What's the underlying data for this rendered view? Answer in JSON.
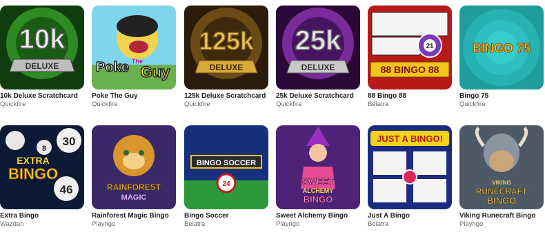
{
  "games": [
    {
      "name": "10k Deluxe Scratchcard",
      "provider": "Quickfire",
      "art": {
        "big": "10k",
        "badge": "DELUXE"
      },
      "bg": "#1d6b1a"
    },
    {
      "name": "Poke The Guy",
      "provider": "Quickfire",
      "art": {
        "big": "Poke",
        "small": "The",
        "big2": "Guy"
      },
      "bg": "#6fd0e6"
    },
    {
      "name": "125k Deluxe Scratchcard",
      "provider": "Quickfire",
      "art": {
        "big": "125k",
        "badge": "DELUXE"
      },
      "bg": "#3a2a14"
    },
    {
      "name": "25k Deluxe Scratchcard",
      "provider": "Quickfire",
      "art": {
        "big": "25k",
        "badge": "DELUXE"
      },
      "bg": "#3a0f4a"
    },
    {
      "name": "88 Bingo 88",
      "provider": "Belatra",
      "art": {
        "big": "88 BINGO 88",
        "ball": "21"
      },
      "bg": "#c51d1d"
    },
    {
      "name": "Bingo 75",
      "provider": "Quickfire",
      "art": {
        "big": "BINGO 75"
      },
      "bg": "#2bb3b3"
    },
    {
      "name": "Extra Bingo",
      "provider": "Wazdan",
      "art": {
        "small": "EXTRA",
        "big": "BINGO",
        "balls": [
          "30",
          "8",
          "46"
        ]
      },
      "bg": "#0f1c3a"
    },
    {
      "name": "Rainforest Magic Bingo",
      "provider": "Playngo",
      "art": {
        "big": "RAINFOREST",
        "small": "MAGIC"
      },
      "bg": "#3f2b6e"
    },
    {
      "name": "Bingo Soccer",
      "provider": "Belatra",
      "art": {
        "big": "BINGO SOCCER",
        "ball": "24"
      },
      "bg": "#1b3f9a"
    },
    {
      "name": "Sweet Alchemy Bingo",
      "provider": "Playngo",
      "art": {
        "big": "SWEET",
        "small": "ALCHEMY",
        "big2": "BINGO"
      },
      "bg": "#5a2a8a"
    },
    {
      "name": "Just A Bingo",
      "provider": "Belatra",
      "art": {
        "big": "JUST A BINGO!"
      },
      "bg": "#1b2f8a"
    },
    {
      "name": "Viking Runecraft Bingo",
      "provider": "Playngo",
      "art": {
        "small": "VIKING",
        "big": "RUNECRAFT",
        "big2": "BINGO"
      },
      "bg": "#5b6a78"
    }
  ]
}
